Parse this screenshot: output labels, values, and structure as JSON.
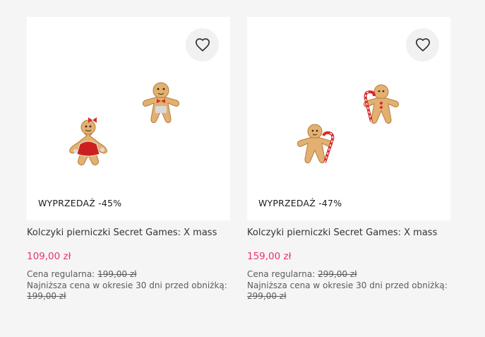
{
  "products": [
    {
      "sale_label": "WYPRZEDAŻ -45%",
      "title": "Kolczyki pierniczki Secret Games: X mass...",
      "price": "109,00 zł",
      "regular_label": "Cena regularna:",
      "regular_price": "199,00 zł",
      "lowest_label": "Najniższa cena w okresie 30 dni przed obniżką:",
      "lowest_price": "199,00 zł",
      "icon": "heart-icon"
    },
    {
      "sale_label": "WYPRZEDAŻ -47%",
      "title": "Kolczyki pierniczki Secret Games: X mass...",
      "price": "159,00 zł",
      "regular_label": "Cena regularna:",
      "regular_price": "299,00 zł",
      "lowest_label": "Najniższa cena w okresie 30 dni przed obniżką:",
      "lowest_price": "299,00 zł",
      "icon": "heart-icon"
    }
  ],
  "colors": {
    "price": "#e8336a",
    "background": "#f5f5f5",
    "card": "#ffffff"
  }
}
